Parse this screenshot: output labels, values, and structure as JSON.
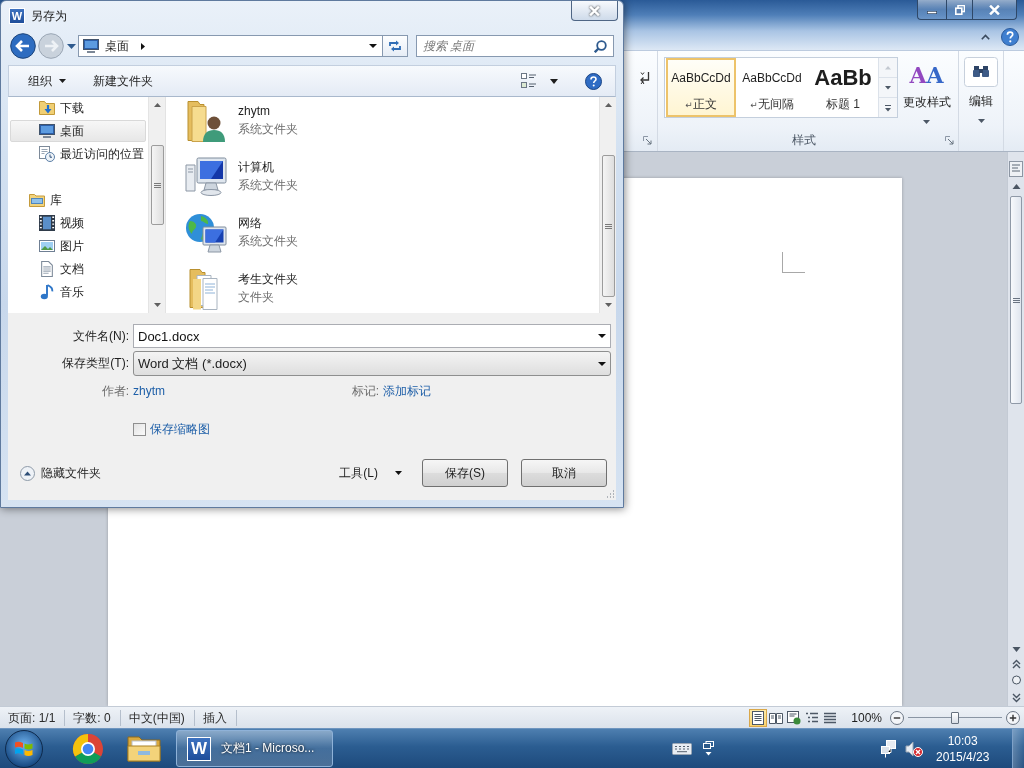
{
  "word_window": {
    "ribbon": {
      "styles_gallery": [
        {
          "preview": "AaBbCcDd",
          "mark": "↵",
          "name": "正文",
          "kind": "normal",
          "selected": true
        },
        {
          "preview": "AaBbCcDd",
          "mark": "↵",
          "name": "无间隔",
          "kind": "normal",
          "selected": false
        },
        {
          "preview": "AaBb",
          "name": "标题 1",
          "kind": "heading",
          "selected": false
        }
      ],
      "styles_group_label": "样式",
      "change_styles": {
        "glyph": "AA",
        "label": "更改样式"
      },
      "editing": "编辑"
    },
    "status_bar": {
      "items": [
        "页面: 1/1",
        "字数: 0",
        "中文(中国)",
        "插入"
      ],
      "views": [
        {
          "kind": "print-layout",
          "selected": true
        },
        {
          "kind": "full-screen-reading",
          "selected": false
        },
        {
          "kind": "web-layout",
          "selected": false
        },
        {
          "kind": "outline",
          "selected": false
        },
        {
          "kind": "draft",
          "selected": false
        }
      ],
      "zoom": "100%",
      "zoom_slider": {
        "level": 0.5
      }
    }
  },
  "save_dialog": {
    "app_icon": "W",
    "title": "另存为",
    "nav_buttons": [
      {
        "kind": "back",
        "disabled": false
      },
      {
        "kind": "forward",
        "disabled": true
      }
    ],
    "address": "桌面",
    "search": {
      "placeholder": "搜索 桌面"
    },
    "toolbar": {
      "organize": "组织",
      "new_folder": "新建文件夹"
    },
    "nav_pane": [
      {
        "children": [
          {
            "label": "下载",
            "kind": "downloads",
            "selected": false
          },
          {
            "label": "桌面",
            "kind": "desktop",
            "selected": true
          },
          {
            "label": "最近访问的位置",
            "kind": "recent",
            "selected": false
          }
        ]
      },
      {
        "label": "库",
        "kind": "library",
        "selected": false,
        "children": [
          {
            "label": "视频",
            "kind": "videos",
            "selected": false
          },
          {
            "label": "图片",
            "kind": "pictures",
            "selected": false
          },
          {
            "label": "文档",
            "kind": "documents",
            "selected": false
          },
          {
            "label": "音乐",
            "kind": "music",
            "selected": false
          }
        ]
      }
    ],
    "files": [
      {
        "name": "zhytm",
        "type": "系统文件夹",
        "kind": "user"
      },
      {
        "name": "计算机",
        "type": "系统文件夹",
        "kind": "computer"
      },
      {
        "name": "网络",
        "type": "系统文件夹",
        "kind": "network"
      },
      {
        "name": "考生文件夹",
        "type": "文件夹",
        "kind": "folder"
      }
    ],
    "file_name": {
      "label": "文件名(N):",
      "value": "Doc1.docx"
    },
    "save_type": {
      "label": "保存类型(T):",
      "value": "Word 文档 (*.docx)"
    },
    "author": {
      "label": "作者:",
      "value": "zhytm"
    },
    "tags": {
      "label": "标记:",
      "value": "添加标记"
    },
    "thumbnail": {
      "label": "保存缩略图",
      "checked": false
    },
    "hide_folders": "隐藏文件夹",
    "tools": "工具(L)",
    "buttons": [
      "保存(S)",
      "取消"
    ]
  },
  "taskbar": {
    "pinned": [
      {
        "kind": "browser"
      },
      {
        "kind": "folder"
      }
    ],
    "windows": [
      {
        "icon": "W",
        "label": "文档1 - Microso..."
      }
    ],
    "clock": {
      "time": "10:03",
      "date": "2015/4/23"
    }
  }
}
